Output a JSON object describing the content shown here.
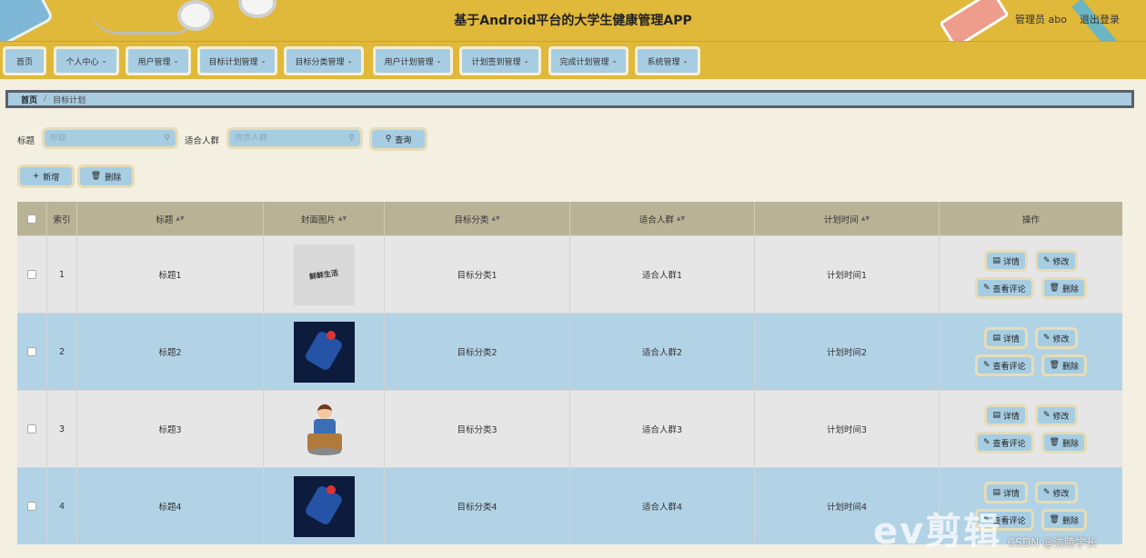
{
  "header": {
    "title": "基于Android平台的大学生健康管理APP",
    "user": "管理员 abo",
    "logout": "退出登录"
  },
  "nav": [
    "首页",
    "个人中心",
    "用户管理",
    "目标计划管理",
    "目标分类管理",
    "用户计划管理",
    "计划签到管理",
    "完成计划管理",
    "系统管理"
  ],
  "breadcrumb": {
    "home": "首页",
    "sep": "/",
    "current": "目标计划"
  },
  "search": {
    "title_label": "标题",
    "title_placeholder": "标题",
    "crowd_label": "适合人群",
    "crowd_placeholder": "适合人群",
    "query_button": "查询"
  },
  "actions": {
    "add": "新增",
    "delete": "删除"
  },
  "table": {
    "headers": [
      "索引",
      "标题",
      "封面图片",
      "目标分类",
      "适合人群",
      "计划时间",
      "操作"
    ],
    "rows": [
      {
        "index": "1",
        "title": "标题1",
        "category": "目标分类1",
        "crowd": "适合人群1",
        "time": "计划时间1",
        "cover_text": "鲜鲜生活"
      },
      {
        "index": "2",
        "title": "标题2",
        "category": "目标分类2",
        "crowd": "适合人群2",
        "time": "计划时间2"
      },
      {
        "index": "3",
        "title": "标题3",
        "category": "目标分类3",
        "crowd": "适合人群3",
        "time": "计划时间3"
      },
      {
        "index": "4",
        "title": "标题4",
        "category": "目标分类4",
        "crowd": "适合人群4",
        "time": "计划时间4"
      }
    ],
    "row_buttons": {
      "detail": "详情",
      "edit": "修改",
      "comments": "查看评论",
      "delete": "删除"
    }
  },
  "watermark": "ev剪辑",
  "csdn": "CSDN @浩陵学长"
}
